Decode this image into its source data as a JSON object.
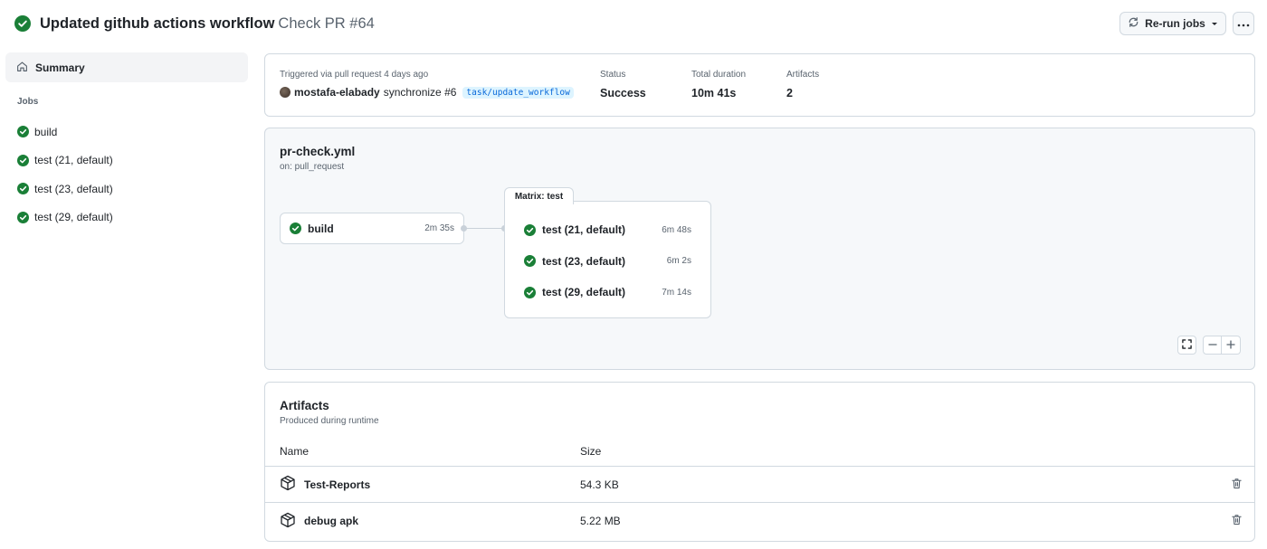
{
  "header": {
    "title": "Updated github actions workflow",
    "subtitle": "Check PR #64",
    "rerun_label": "Re-run jobs",
    "more_label": "···"
  },
  "sidebar": {
    "summary_label": "Summary",
    "jobs_heading": "Jobs",
    "jobs": [
      {
        "label": "build",
        "status": "success"
      },
      {
        "label": "test (21, default)",
        "status": "success"
      },
      {
        "label": "test (23, default)",
        "status": "success"
      },
      {
        "label": "test (29, default)",
        "status": "success"
      }
    ]
  },
  "summary": {
    "triggered_text": "Triggered via pull request 4 days ago",
    "actor": "mostafa-elabady",
    "event": "synchronize #6",
    "branch": "task/update_workflow",
    "status_label": "Status",
    "status_value": "Success",
    "duration_label": "Total duration",
    "duration_value": "10m 41s",
    "artifacts_label": "Artifacts",
    "artifacts_value": "2"
  },
  "graph": {
    "workflow_file": "pr-check.yml",
    "trigger": "on: pull_request",
    "build_job": {
      "name": "build",
      "duration": "2m 35s"
    },
    "matrix_label": "Matrix: test",
    "matrix_jobs": [
      {
        "name": "test (21, default)",
        "duration": "6m 48s"
      },
      {
        "name": "test (23, default)",
        "duration": "6m 2s"
      },
      {
        "name": "test (29, default)",
        "duration": "7m 14s"
      }
    ]
  },
  "artifacts": {
    "title": "Artifacts",
    "subtitle": "Produced during runtime",
    "col_name": "Name",
    "col_size": "Size",
    "rows": [
      {
        "name": "Test-Reports",
        "size": "54.3 KB"
      },
      {
        "name": "debug apk",
        "size": "5.22 MB"
      }
    ]
  },
  "colors": {
    "success": "#1a7f37",
    "branch_text": "#0969da",
    "branch_bg": "#ddf4ff",
    "muted_text": "#59636e",
    "border": "#d1d9e0"
  },
  "icons": {
    "status": "check-circle-icon",
    "rerun": "sync-icon",
    "summary": "home-icon",
    "artifact": "package-icon",
    "delete": "trash-icon",
    "fullscreen": "screen-full-icon",
    "zoom_out": "dash-icon",
    "zoom_in": "plus-icon"
  }
}
